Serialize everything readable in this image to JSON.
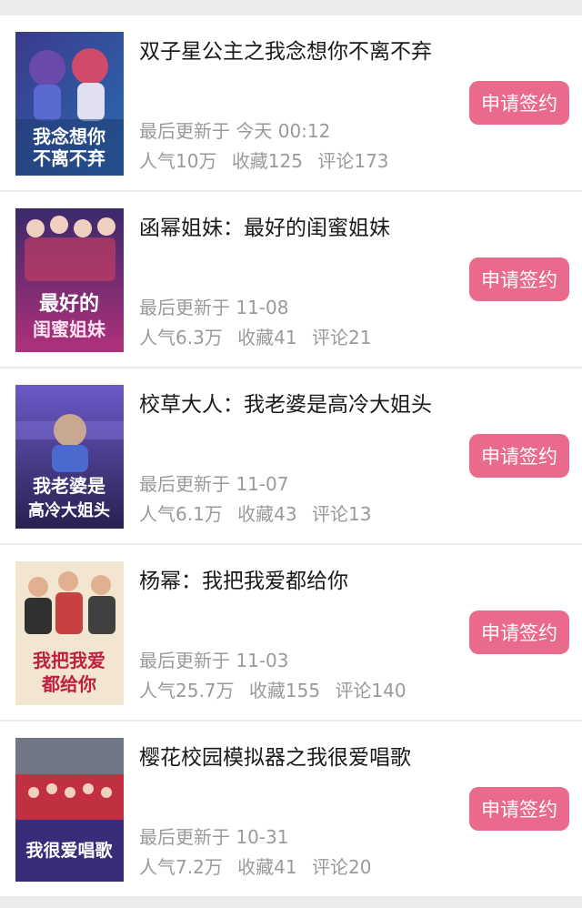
{
  "button_label": "申请签约",
  "accent_color": "#ea6a8c",
  "books": [
    {
      "title": "双子星公主之我念想你不离不弃",
      "updated": "最后更新于 今天 00:12",
      "popularity": "人气10万",
      "favorites": "收藏125",
      "comments": "评论173",
      "cover_text": [
        "我念想你",
        "不离不弃"
      ],
      "cover_colors": [
        "#3b3a8c",
        "#2a6bb0"
      ]
    },
    {
      "title": "函幂姐妹：最好的闺蜜姐妹",
      "updated": "最后更新于 11-08",
      "popularity": "人气6.3万",
      "favorites": "收藏41",
      "comments": "评论21",
      "cover_text": [
        "最好的",
        "闺蜜姐妹"
      ],
      "cover_colors": [
        "#3a2a6b",
        "#b0307a"
      ]
    },
    {
      "title": "校草大人：我老婆是高冷大姐头",
      "updated": "最后更新于 11-07",
      "popularity": "人气6.1万",
      "favorites": "收藏43",
      "comments": "评论13",
      "cover_text": [
        "我老婆是",
        "高冷大姐头"
      ],
      "cover_colors": [
        "#4a3a9a",
        "#2a2050"
      ]
    },
    {
      "title": "杨幂：我把我爱都给你",
      "updated": "最后更新于 11-03",
      "popularity": "人气25.7万",
      "favorites": "收藏155",
      "comments": "评论140",
      "cover_text": [
        "我把我爱",
        "都给你"
      ],
      "cover_colors": [
        "#f2e6d0",
        "#c84040"
      ]
    },
    {
      "title": "樱花校园模拟器之我很爱唱歌",
      "updated": "最后更新于 10-31",
      "popularity": "人气7.2万",
      "favorites": "收藏41",
      "comments": "评论20",
      "cover_text": [
        "我很爱唱歌",
        ""
      ],
      "cover_colors": [
        "#c03040",
        "#3a2a7a"
      ]
    }
  ]
}
